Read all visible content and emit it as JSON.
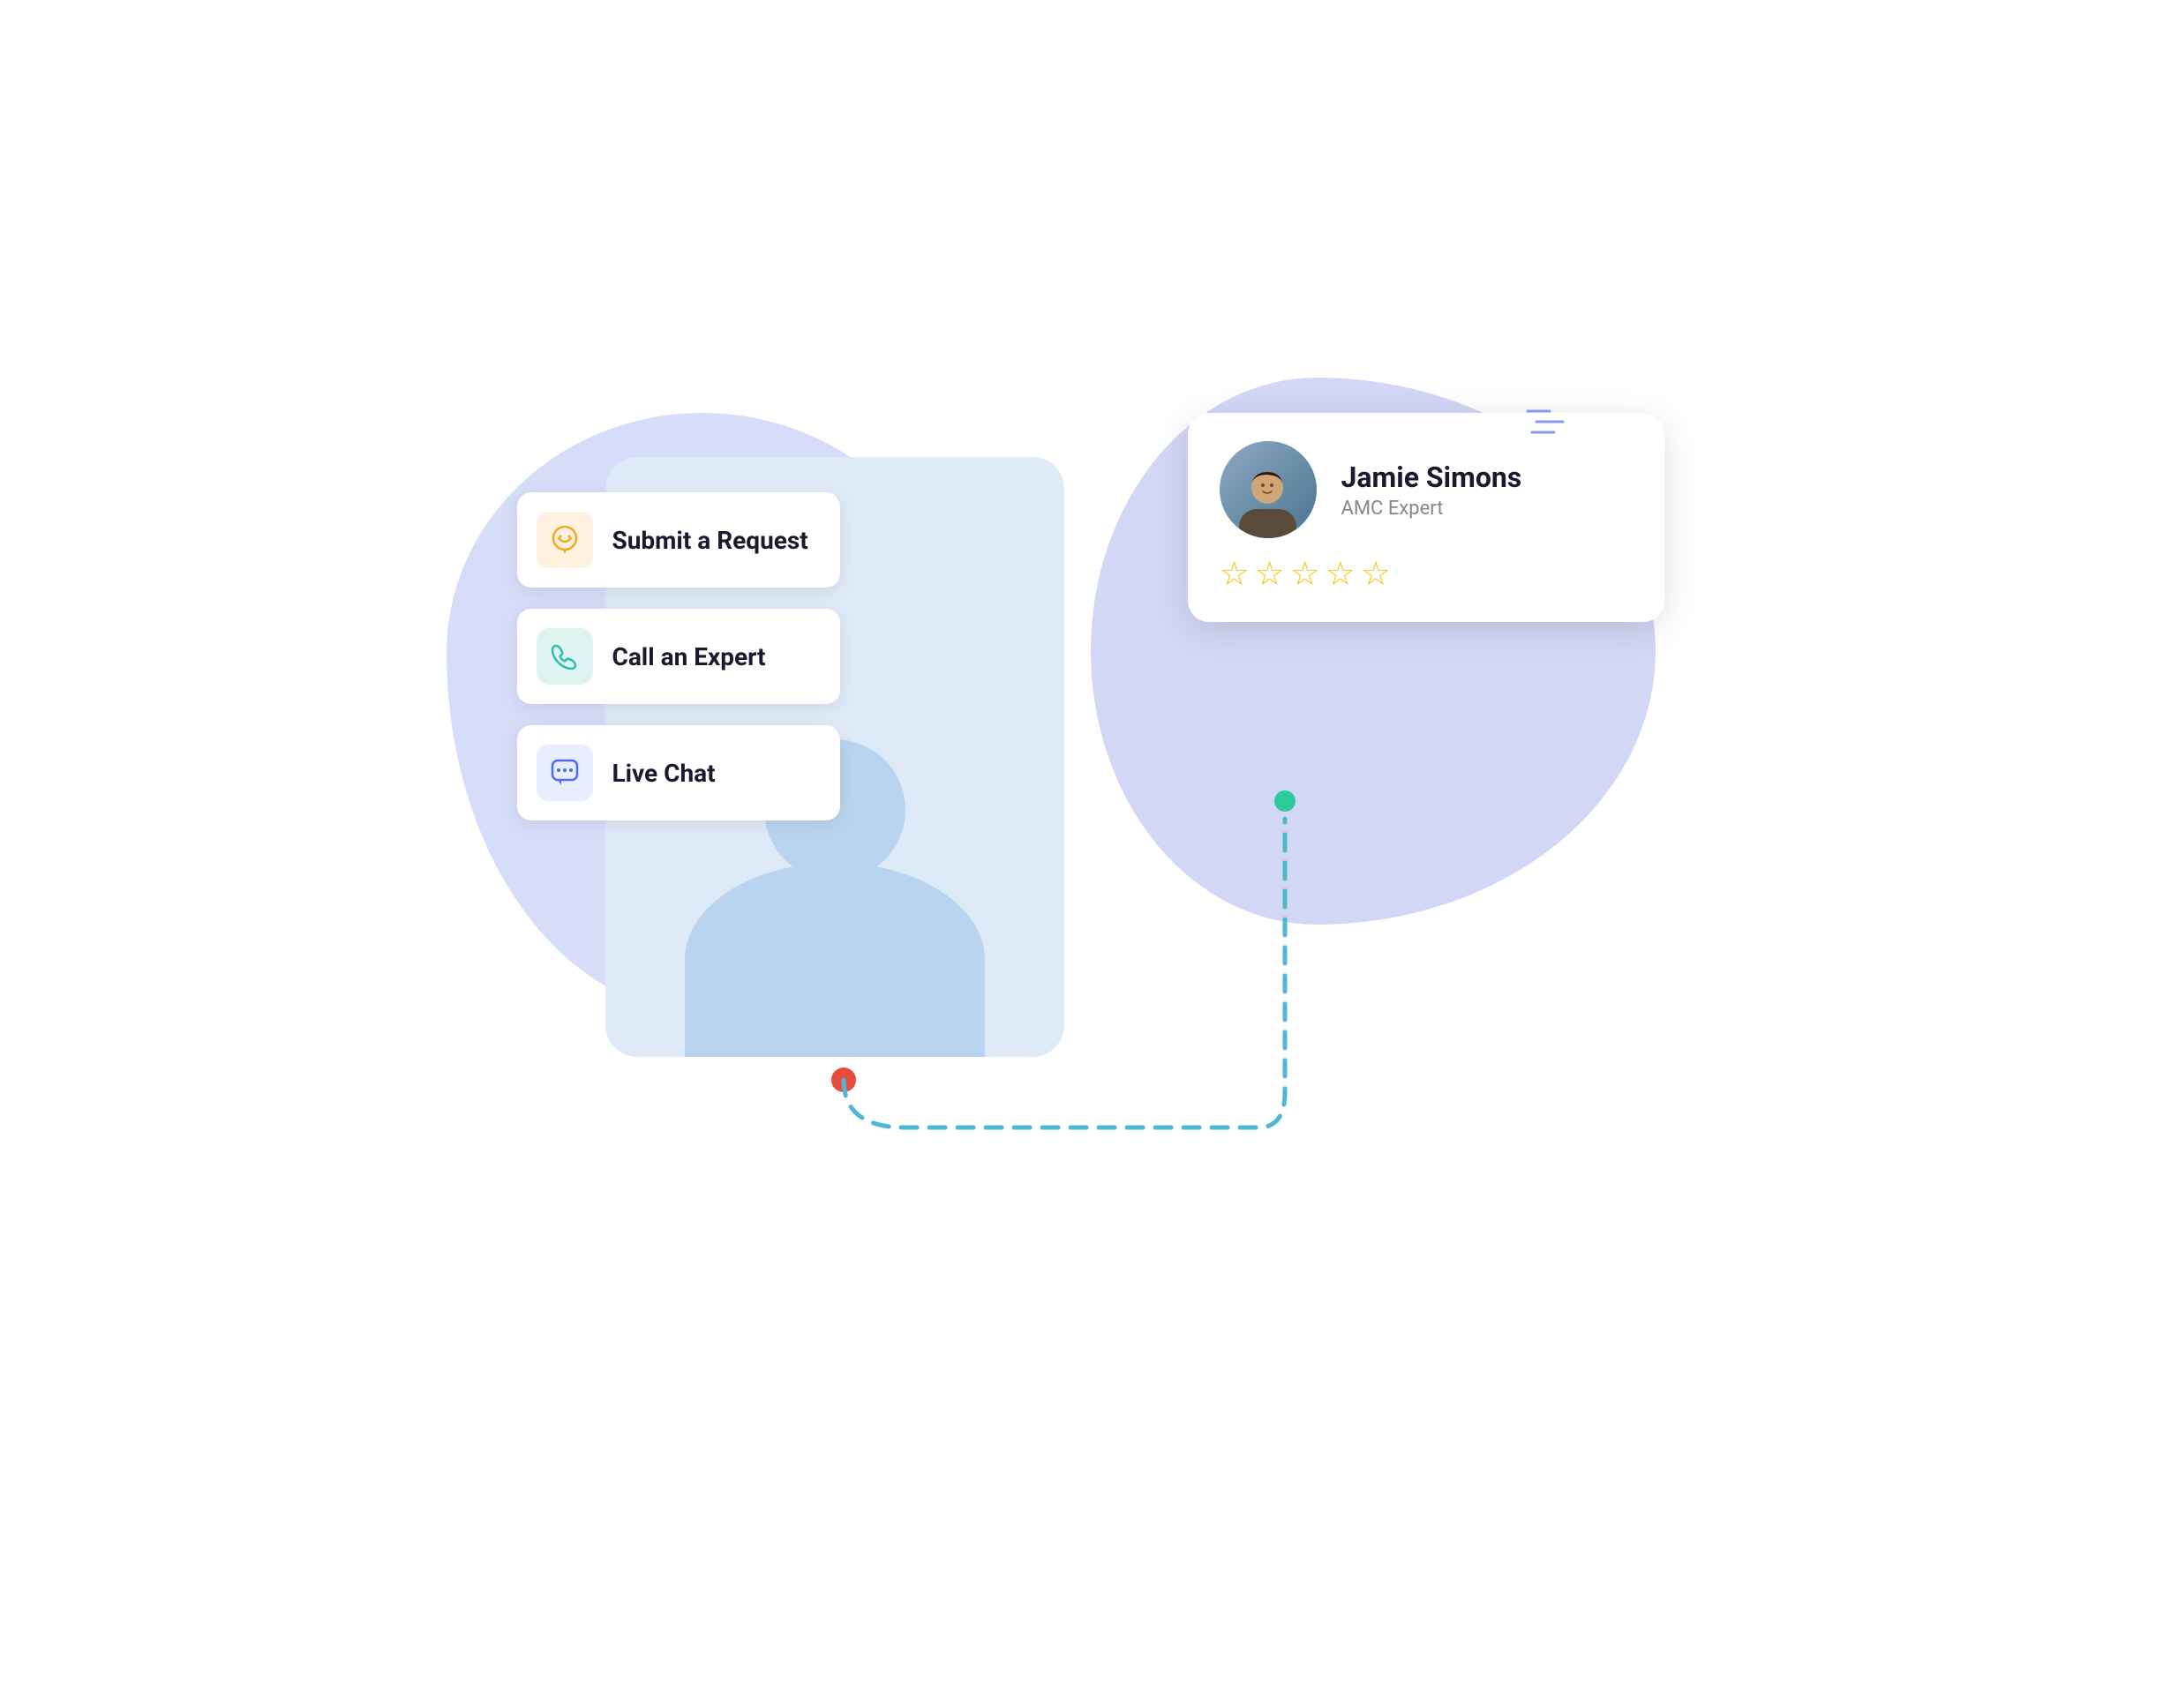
{
  "scene": {
    "menu_items": [
      {
        "id": "submit-request",
        "label": "Submit a Request",
        "icon_type": "question-bubble",
        "icon_color": "yellow",
        "icon_unicode": "💬"
      },
      {
        "id": "call-expert",
        "label": "Call an Expert",
        "icon_type": "phone",
        "icon_color": "teal",
        "icon_unicode": "📞"
      },
      {
        "id": "live-chat",
        "label": "Live Chat",
        "icon_type": "chat-bubble",
        "icon_color": "blue",
        "icon_unicode": "💬"
      }
    ],
    "expert_card": {
      "name": "Jamie Simons",
      "role": "AMC Expert",
      "stars": 5,
      "star_char": "☆"
    },
    "connector": {
      "dot_bottom_color": "#e74c3c",
      "dot_top_color": "#2ecc9a",
      "line_color": "#4db8d4"
    },
    "deco_lines_color": "#8899ee"
  }
}
